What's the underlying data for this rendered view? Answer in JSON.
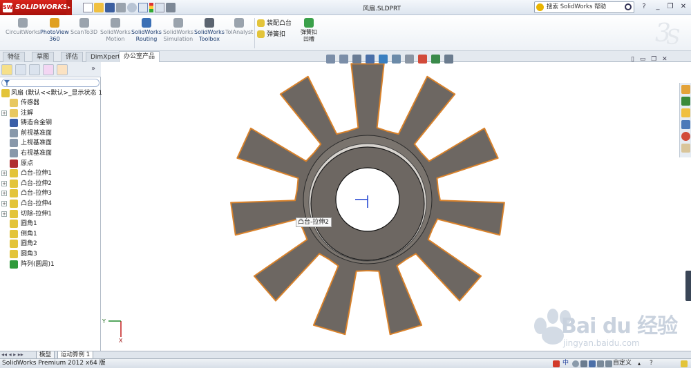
{
  "app": {
    "logo_text": "SOLIDWORKS",
    "logo_mark": "SW",
    "document_title": "风扇.SLDPRT",
    "search_placeholder": "搜索 SolidWorks 帮助",
    "help_label": "?"
  },
  "command_manager": {
    "items": [
      {
        "label_1": "CircuitWorks",
        "label_2": "",
        "enabled": false,
        "icon": "circuitworks-icon",
        "color": "#9aa3ad"
      },
      {
        "label_1": "PhotoView",
        "label_2": "360",
        "enabled": true,
        "icon": "photoview-icon",
        "color": "#e0a020"
      },
      {
        "label_1": "ScanTo3D",
        "label_2": "",
        "enabled": false,
        "icon": "scanto3d-icon",
        "color": "#9aa3ad"
      },
      {
        "label_1": "SolidWorks",
        "label_2": "Motion",
        "enabled": false,
        "icon": "motion-icon",
        "color": "#9aa3ad"
      },
      {
        "label_1": "SolidWorks",
        "label_2": "Routing",
        "enabled": true,
        "icon": "routing-icon",
        "color": "#3a6fb5"
      },
      {
        "label_1": "SolidWorks",
        "label_2": "Simulation",
        "enabled": false,
        "icon": "simulation-icon",
        "color": "#9aa3ad"
      },
      {
        "label_1": "SolidWorks",
        "label_2": "Toolbox",
        "enabled": true,
        "icon": "toolbox-icon",
        "color": "#5b6470"
      },
      {
        "label_1": "TolAnalyst",
        "label_2": "",
        "enabled": false,
        "icon": "tolanalyst-icon",
        "color": "#9aa3ad"
      }
    ],
    "small_items": [
      {
        "label": "装配凸台",
        "icon": "mount-boss-icon"
      },
      {
        "label": "弹簧扣",
        "icon": "snap-hook-icon"
      }
    ],
    "big_item": {
      "label_1": "弹簧扣",
      "label_2": "凹槽",
      "icon": "snap-hook-groove-icon"
    }
  },
  "tabs": [
    {
      "label": "特征",
      "active": false
    },
    {
      "label": "草图",
      "active": false
    },
    {
      "label": "评估",
      "active": false
    },
    {
      "label": "DimXpert",
      "active": false
    },
    {
      "label": "办公室产品",
      "active": true
    }
  ],
  "feature_tree": {
    "root": "风扇  (默认<<默认>_显示状态 1",
    "items": [
      {
        "label": "传感器",
        "expandable": false,
        "icon": "sensor-icon",
        "color": "#e8c860"
      },
      {
        "label": "注解",
        "expandable": true,
        "icon": "annotation-icon",
        "color": "#e8c860"
      },
      {
        "label": "铸造合金钢",
        "expandable": false,
        "icon": "material-icon",
        "color": "#3b5fa8"
      },
      {
        "label": "前视基准面",
        "expandable": false,
        "icon": "plane-icon",
        "color": "#8898aa"
      },
      {
        "label": "上视基准面",
        "expandable": false,
        "icon": "plane-icon",
        "color": "#8898aa"
      },
      {
        "label": "右视基准面",
        "expandable": false,
        "icon": "plane-icon",
        "color": "#8898aa"
      },
      {
        "label": "原点",
        "expandable": false,
        "icon": "origin-icon",
        "color": "#b03030"
      },
      {
        "label": "凸台-拉伸1",
        "expandable": true,
        "icon": "boss-extrude-icon",
        "color": "#e3c43a"
      },
      {
        "label": "凸台-拉伸2",
        "expandable": true,
        "icon": "boss-extrude-icon",
        "color": "#e3c43a"
      },
      {
        "label": "凸台-拉伸3",
        "expandable": true,
        "icon": "boss-extrude-icon",
        "color": "#e3c43a"
      },
      {
        "label": "凸台-拉伸4",
        "expandable": true,
        "icon": "boss-extrude-icon",
        "color": "#e3c43a"
      },
      {
        "label": "切除-拉伸1",
        "expandable": true,
        "icon": "cut-extrude-icon",
        "color": "#e3c43a"
      },
      {
        "label": "圆角1",
        "expandable": false,
        "icon": "fillet-icon",
        "color": "#e3c43a"
      },
      {
        "label": "倒角1",
        "expandable": false,
        "icon": "chamfer-icon",
        "color": "#e3c43a"
      },
      {
        "label": "圆角2",
        "expandable": false,
        "icon": "fillet-icon",
        "color": "#e3c43a"
      },
      {
        "label": "圆角3",
        "expandable": false,
        "icon": "fillet-icon",
        "color": "#e3c43a"
      },
      {
        "label": "阵列(圆周)1",
        "expandable": false,
        "icon": "circular-pattern-icon",
        "color": "#2f9a3a"
      }
    ]
  },
  "viewport": {
    "tooltip": "凸台-拉伸2",
    "part_color": "#6d6762",
    "edge_color": "#d9822b",
    "triad_y": "Y",
    "triad_x": "X"
  },
  "bottom_tabs": [
    "模型",
    "运动算例 1"
  ],
  "status": {
    "left": "SolidWorks Premium 2012 x64 版",
    "right": "自定义"
  },
  "watermark": {
    "text": "Bai  du 经验",
    "url": "jingyan.baidu.com"
  }
}
